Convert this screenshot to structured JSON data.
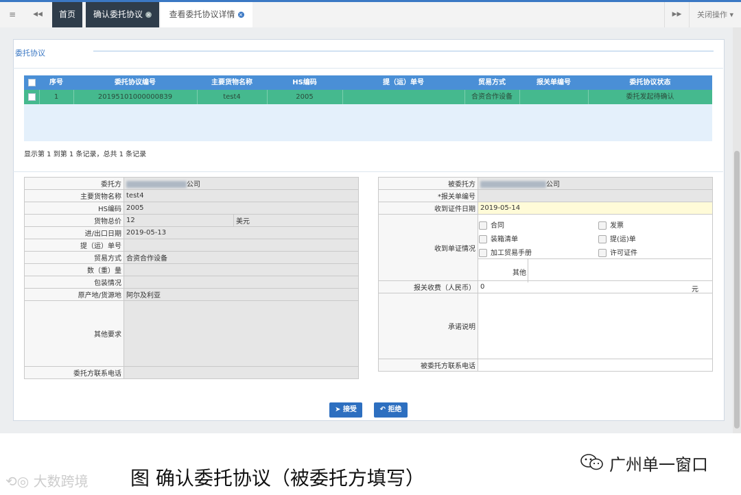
{
  "tabs": {
    "menu_icon": "≡",
    "prev_icon": "◀◀",
    "home": "首页",
    "tab1": "确认委托协议",
    "tab2": "查看委托协议详情",
    "next_icon": "▶▶",
    "close_ops": "关闭操作"
  },
  "panel": {
    "title": "委托协议"
  },
  "grid": {
    "headers": [
      "序号",
      "委托协议编号",
      "主要货物名称",
      "HS编码",
      "提（运）单号",
      "贸易方式",
      "报关单编号",
      "委托协议状态"
    ],
    "row": [
      "1",
      "20195101000000839",
      "test4",
      "2005",
      "",
      "合资合作设备",
      "",
      "委托发起待确认"
    ],
    "pager": "显示第 1 到第 1 条记录，总共 1 条记录"
  },
  "left_form": {
    "client_label": "委托方",
    "client_value": "公司",
    "goods_label": "主要货物名称",
    "goods_value": "test4",
    "hs_label": "HS编码",
    "hs_value": "2005",
    "total_label": "货物总价",
    "total_value": "12",
    "currency": "美元",
    "date_label": "进/出口日期",
    "date_value": "2019-05-13",
    "bl_label": "提（运）单号",
    "trade_label": "贸易方式",
    "trade_value": "合资合作设备",
    "qty_label": "数（重）量",
    "pack_label": "包装情况",
    "origin_label": "原产地/货源地",
    "origin_value": "阿尔及利亚",
    "other_label": "其他要求",
    "phone_label": "委托方联系电话"
  },
  "right_form": {
    "agent_label": "被委托方",
    "agent_value": "公司",
    "decl_label": "*报关单编号",
    "recv_date_label": "收到证件日期",
    "recv_date_value": "2019-05-14",
    "docs_label": "收到单证情况",
    "doc_contract": "合同",
    "doc_invoice": "发票",
    "doc_packing": "装箱清单",
    "doc_bl": "提(运)单",
    "doc_handbook": "加工贸易手册",
    "doc_license": "许可证件",
    "doc_other": "其他",
    "fee_label": "报关收费（人民币）",
    "fee_value": "0",
    "fee_unit": "元",
    "promise_label": "承诺说明",
    "agent_phone_label": "被委托方联系电话"
  },
  "buttons": {
    "accept": "接受",
    "reject": "拒绝"
  },
  "caption": {
    "text": "图  确认委托协议（被委托方填写）",
    "watermark": "广州单一窗口",
    "logo": "大数跨境"
  }
}
